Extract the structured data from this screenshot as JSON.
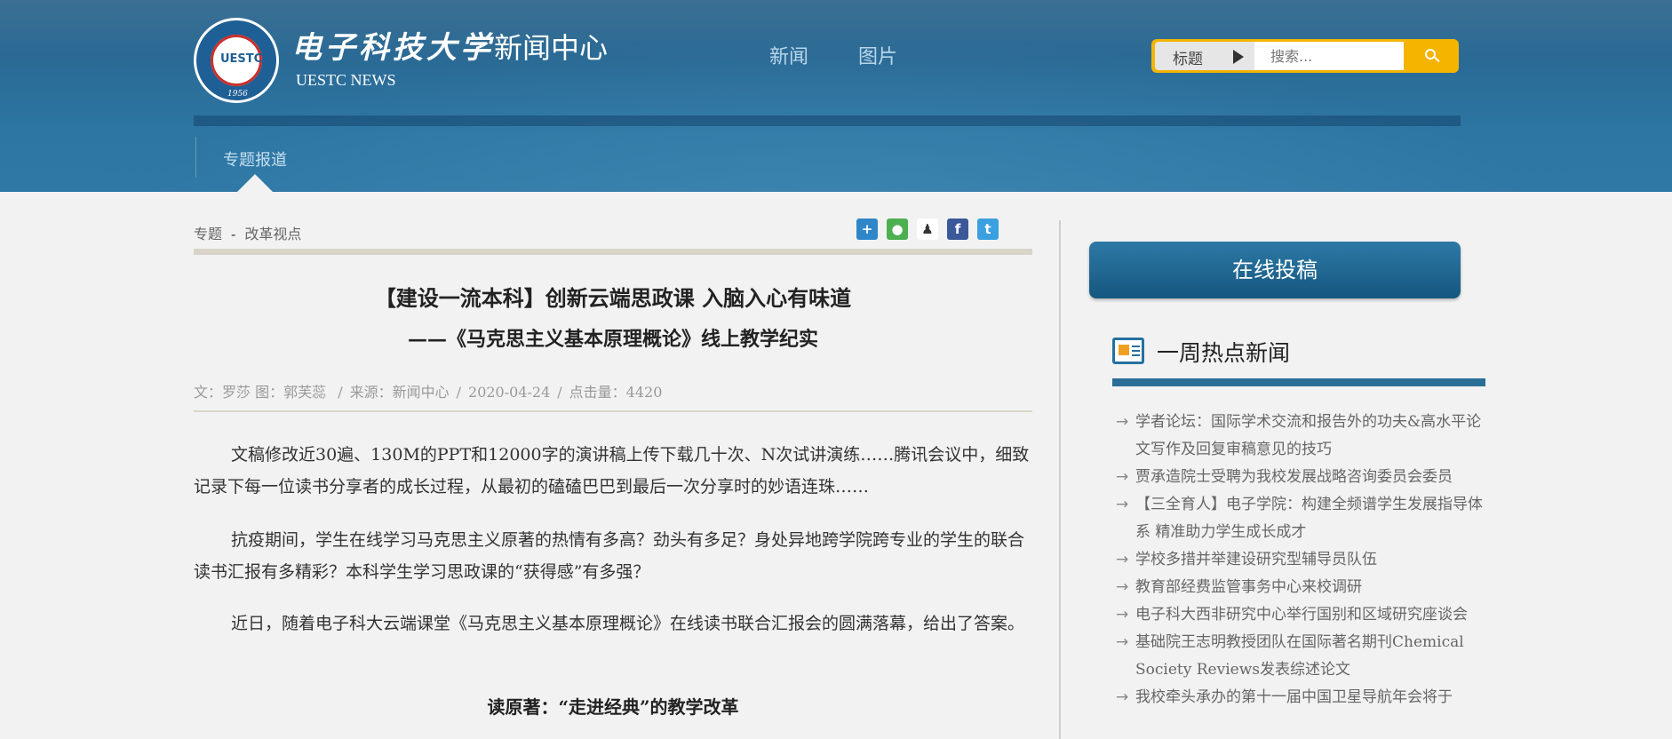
{
  "header": {
    "site_name": "电子科技大学",
    "site_section": "新闻中心",
    "site_en": "UESTC NEWS",
    "logo_text": "UESTC",
    "logo_year": "1956",
    "nav": [
      "新闻",
      "图片"
    ],
    "search": {
      "category": "标题",
      "placeholder": "搜索...",
      "button_icon": "search-icon"
    },
    "subnav": "专题报道"
  },
  "breadcrumb": {
    "section": "专题",
    "separator": "-",
    "topic": "改革视点"
  },
  "share_icons": [
    "plus-icon",
    "wechat-icon",
    "qq-icon",
    "facebook-icon",
    "twitter-icon"
  ],
  "article": {
    "title": "【建设一流本科】创新云端思政课 入脑入心有味道",
    "subtitle": "——《马克思主义基本原理概论》线上教学纪实",
    "meta": {
      "author": "文：罗莎",
      "photo": "图：郭芙蕊",
      "source": "来源：新闻中心",
      "date": "2020-04-24",
      "clicks": "点击量：4420",
      "separator": "/"
    },
    "paragraphs": [
      "文稿修改近30遍、130M的PPT和12000字的演讲稿上传下载几十次、N次试讲演练……腾讯会议中，细致记录下每一位读书分享者的成长过程，从最初的磕磕巴巴到最后一次分享时的妙语连珠……",
      "抗疫期间，学生在线学习马克思主义原著的热情有多高？劲头有多足？身处异地跨学院跨专业的学生的联合读书汇报有多精彩？本科学生学习思政课的“获得感”有多强？",
      "近日，随着电子科大云端课堂《马克思主义基本原理概论》在线读书联合汇报会的圆满落幕，给出了答案。"
    ],
    "subhead": "读原著：“走进经典”的教学改革"
  },
  "sidebar": {
    "submit_label": "在线投稿",
    "hot_title": "一周热点新闻",
    "hot_items": [
      "学者论坛：国际学术交流和报告外的功夫&高水平论文写作及回复审稿意见的技巧",
      "贾承造院士受聘为我校发展战略咨询委员会委员",
      "【三全育人】电子学院：构建全频谱学生发展指导体系 精准助力学生成长成才",
      "学校多措并举建设研究型辅导员队伍",
      "教育部经费监管事务中心来校调研",
      "电子科大西非研究中心举行国别和区域研究座谈会",
      "基础院王志明教授团队在国际著名期刊Chemical Society Reviews发表综述论文",
      "我校牵头承办的第十一届中国卫星导航年会将于"
    ],
    "arrow": "→"
  },
  "colors": {
    "header_blue": "#2a6a95",
    "search_accent": "#f4b400",
    "button_blue": "#15577f"
  }
}
